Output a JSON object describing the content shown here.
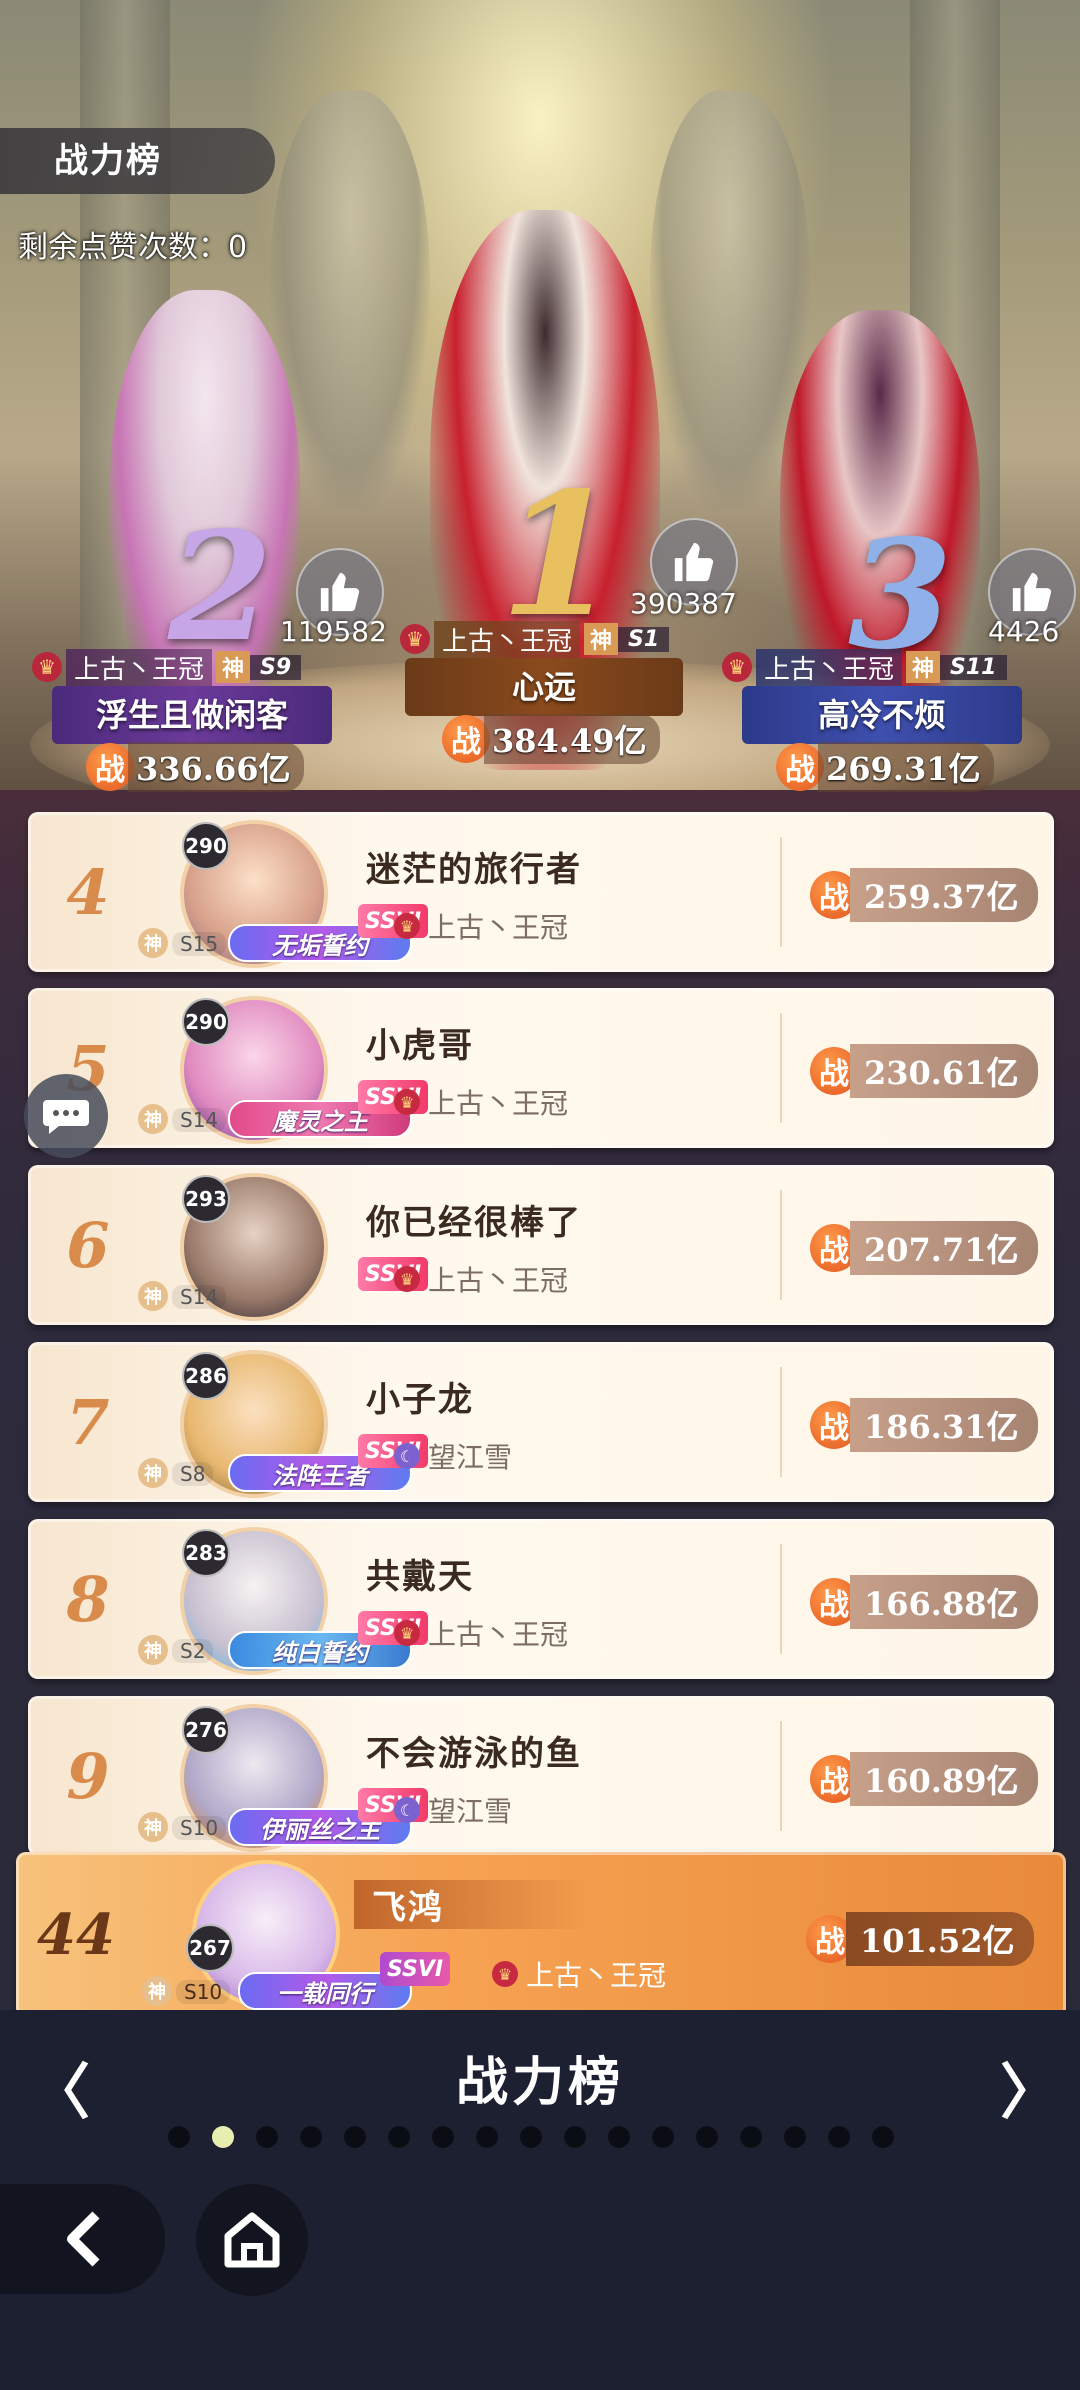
{
  "header": {
    "title": "战力榜",
    "likes_remaining": "剩余点赞次数：0"
  },
  "podium": [
    {
      "rank": "2",
      "likes": "119582",
      "guild": "上古丶王冠",
      "god": "神",
      "season": "S9",
      "name": "浮生且做闲客",
      "power_icon": "战",
      "power": "336.66亿"
    },
    {
      "rank": "1",
      "likes": "390387",
      "guild": "上古丶王冠",
      "god": "神",
      "season": "S1",
      "name": "心远",
      "power_icon": "战",
      "power": "384.49亿"
    },
    {
      "rank": "3",
      "likes": "4426",
      "guild": "上古丶王冠",
      "god": "神",
      "season": "S11",
      "name": "高冷不烦",
      "power_icon": "战",
      "power": "269.31亿"
    }
  ],
  "rows": [
    {
      "rank": "4",
      "level": "290",
      "name": "迷茫的旅行者",
      "title": "无垢誓约",
      "god": "神",
      "season": "S15",
      "vip": "SSVI",
      "guild": "上古丶王冠",
      "power_icon": "战",
      "power": "259.37亿"
    },
    {
      "rank": "5",
      "level": "290",
      "name": "小虎哥",
      "title": "魔灵之王",
      "god": "神",
      "season": "S14",
      "vip": "SSVI",
      "guild": "上古丶王冠",
      "power_icon": "战",
      "power": "230.61亿"
    },
    {
      "rank": "6",
      "level": "293",
      "name": "你已经很棒了",
      "title": "",
      "god": "神",
      "season": "S14",
      "vip": "SSVI",
      "guild": "上古丶王冠",
      "power_icon": "战",
      "power": "207.71亿"
    },
    {
      "rank": "7",
      "level": "286",
      "name": "小子龙",
      "title": "法阵王者",
      "god": "神",
      "season": "S8",
      "vip": "SSVI",
      "guild": "望江雪",
      "power_icon": "战",
      "power": "186.31亿"
    },
    {
      "rank": "8",
      "level": "283",
      "name": "共戴天",
      "title": "纯白誓约",
      "god": "神",
      "season": "S2",
      "vip": "SSVI",
      "guild": "上古丶王冠",
      "power_icon": "战",
      "power": "166.88亿"
    },
    {
      "rank": "9",
      "level": "276",
      "name": "不会游泳的鱼",
      "title": "伊丽丝之主",
      "god": "神",
      "season": "S10",
      "vip": "SSVI",
      "guild": "望江雪",
      "power_icon": "战",
      "power": "160.89亿"
    }
  ],
  "self_row": {
    "rank": "44",
    "level": "267",
    "name": "飞鸿",
    "title": "一载同行",
    "god": "神",
    "season": "S10",
    "vip": "SSVI",
    "guild": "上古丶王冠",
    "power_icon": "战",
    "power": "101.52亿"
  },
  "footer": {
    "title": "战力榜",
    "prev": "〈",
    "next": "〉",
    "page_count": 17,
    "active_page": 2
  },
  "colors": {
    "accent": "#e2551f",
    "row_bg": "#fff8ee",
    "self_row_bg": "#f6a353",
    "title_bg": "#3c3a3e"
  },
  "icons": {
    "thumb": "thumbs-up-icon",
    "crown": "crown-icon",
    "chat": "chat-bubble-icon",
    "back": "back-arrow-icon",
    "home": "home-icon"
  }
}
